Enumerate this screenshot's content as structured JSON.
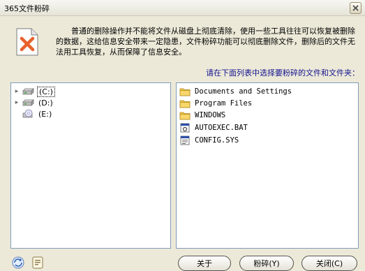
{
  "window": {
    "title": "365文件粉碎"
  },
  "header": {
    "description": "普通的删除操作并不能将文件从磁盘上彻底清除，使用一些工具往往可以恢复被删除的数据，这给信息安全带来一定隐患，文件粉碎功能可以彻底删除文件，删除后的文件无法用工具恢复，从而保障了信息安全。"
  },
  "instruction": "请在下面列表中选择要粉碎的文件和文件夹：",
  "drive_tree": [
    {
      "label": "(C:)",
      "icon": "hard-drive-icon",
      "selected": true,
      "expandable": true
    },
    {
      "label": "(D:)",
      "icon": "hard-drive-icon",
      "selected": false,
      "expandable": true
    },
    {
      "label": "(E:)",
      "icon": "cd-drive-icon",
      "selected": false,
      "expandable": false
    }
  ],
  "file_list": [
    {
      "name": "Documents and Settings",
      "icon": "folder-icon"
    },
    {
      "name": "Program Files",
      "icon": "folder-icon"
    },
    {
      "name": "WINDOWS",
      "icon": "folder-icon"
    },
    {
      "name": "AUTOEXEC.BAT",
      "icon": "batch-file-icon"
    },
    {
      "name": "CONFIG.SYS",
      "icon": "system-file-icon"
    }
  ],
  "buttons": {
    "about": "关于",
    "shred": "粉碎(Y)",
    "close": "关闭(C)"
  },
  "colors": {
    "window_bg": "#ece9d8",
    "instruction_text": "#12128f",
    "panel_border": "#7f9db9",
    "folder": "#f2c94c",
    "shred_icon_x": "#e8622c"
  }
}
